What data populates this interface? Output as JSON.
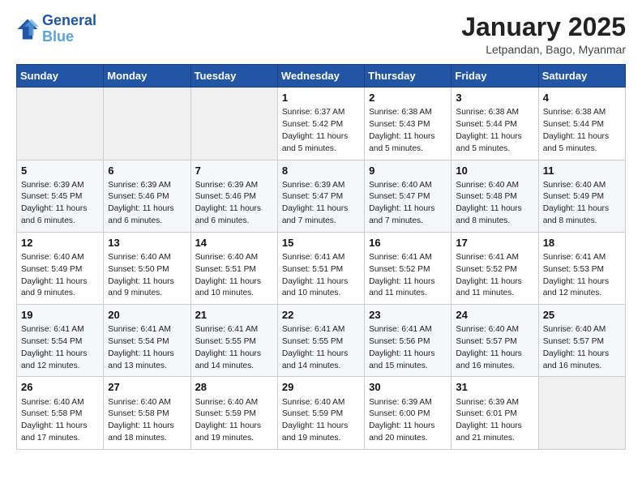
{
  "logo": {
    "text_general": "General",
    "text_blue": "Blue"
  },
  "header": {
    "month": "January 2025",
    "location": "Letpandan, Bago, Myanmar"
  },
  "weekdays": [
    "Sunday",
    "Monday",
    "Tuesday",
    "Wednesday",
    "Thursday",
    "Friday",
    "Saturday"
  ],
  "weeks": [
    [
      {
        "day": "",
        "info": ""
      },
      {
        "day": "",
        "info": ""
      },
      {
        "day": "",
        "info": ""
      },
      {
        "day": "1",
        "info": "Sunrise: 6:37 AM\nSunset: 5:42 PM\nDaylight: 11 hours\nand 5 minutes."
      },
      {
        "day": "2",
        "info": "Sunrise: 6:38 AM\nSunset: 5:43 PM\nDaylight: 11 hours\nand 5 minutes."
      },
      {
        "day": "3",
        "info": "Sunrise: 6:38 AM\nSunset: 5:44 PM\nDaylight: 11 hours\nand 5 minutes."
      },
      {
        "day": "4",
        "info": "Sunrise: 6:38 AM\nSunset: 5:44 PM\nDaylight: 11 hours\nand 5 minutes."
      }
    ],
    [
      {
        "day": "5",
        "info": "Sunrise: 6:39 AM\nSunset: 5:45 PM\nDaylight: 11 hours\nand 6 minutes."
      },
      {
        "day": "6",
        "info": "Sunrise: 6:39 AM\nSunset: 5:46 PM\nDaylight: 11 hours\nand 6 minutes."
      },
      {
        "day": "7",
        "info": "Sunrise: 6:39 AM\nSunset: 5:46 PM\nDaylight: 11 hours\nand 6 minutes."
      },
      {
        "day": "8",
        "info": "Sunrise: 6:39 AM\nSunset: 5:47 PM\nDaylight: 11 hours\nand 7 minutes."
      },
      {
        "day": "9",
        "info": "Sunrise: 6:40 AM\nSunset: 5:47 PM\nDaylight: 11 hours\nand 7 minutes."
      },
      {
        "day": "10",
        "info": "Sunrise: 6:40 AM\nSunset: 5:48 PM\nDaylight: 11 hours\nand 8 minutes."
      },
      {
        "day": "11",
        "info": "Sunrise: 6:40 AM\nSunset: 5:49 PM\nDaylight: 11 hours\nand 8 minutes."
      }
    ],
    [
      {
        "day": "12",
        "info": "Sunrise: 6:40 AM\nSunset: 5:49 PM\nDaylight: 11 hours\nand 9 minutes."
      },
      {
        "day": "13",
        "info": "Sunrise: 6:40 AM\nSunset: 5:50 PM\nDaylight: 11 hours\nand 9 minutes."
      },
      {
        "day": "14",
        "info": "Sunrise: 6:40 AM\nSunset: 5:51 PM\nDaylight: 11 hours\nand 10 minutes."
      },
      {
        "day": "15",
        "info": "Sunrise: 6:41 AM\nSunset: 5:51 PM\nDaylight: 11 hours\nand 10 minutes."
      },
      {
        "day": "16",
        "info": "Sunrise: 6:41 AM\nSunset: 5:52 PM\nDaylight: 11 hours\nand 11 minutes."
      },
      {
        "day": "17",
        "info": "Sunrise: 6:41 AM\nSunset: 5:52 PM\nDaylight: 11 hours\nand 11 minutes."
      },
      {
        "day": "18",
        "info": "Sunrise: 6:41 AM\nSunset: 5:53 PM\nDaylight: 11 hours\nand 12 minutes."
      }
    ],
    [
      {
        "day": "19",
        "info": "Sunrise: 6:41 AM\nSunset: 5:54 PM\nDaylight: 11 hours\nand 12 minutes."
      },
      {
        "day": "20",
        "info": "Sunrise: 6:41 AM\nSunset: 5:54 PM\nDaylight: 11 hours\nand 13 minutes."
      },
      {
        "day": "21",
        "info": "Sunrise: 6:41 AM\nSunset: 5:55 PM\nDaylight: 11 hours\nand 14 minutes."
      },
      {
        "day": "22",
        "info": "Sunrise: 6:41 AM\nSunset: 5:55 PM\nDaylight: 11 hours\nand 14 minutes."
      },
      {
        "day": "23",
        "info": "Sunrise: 6:41 AM\nSunset: 5:56 PM\nDaylight: 11 hours\nand 15 minutes."
      },
      {
        "day": "24",
        "info": "Sunrise: 6:40 AM\nSunset: 5:57 PM\nDaylight: 11 hours\nand 16 minutes."
      },
      {
        "day": "25",
        "info": "Sunrise: 6:40 AM\nSunset: 5:57 PM\nDaylight: 11 hours\nand 16 minutes."
      }
    ],
    [
      {
        "day": "26",
        "info": "Sunrise: 6:40 AM\nSunset: 5:58 PM\nDaylight: 11 hours\nand 17 minutes."
      },
      {
        "day": "27",
        "info": "Sunrise: 6:40 AM\nSunset: 5:58 PM\nDaylight: 11 hours\nand 18 minutes."
      },
      {
        "day": "28",
        "info": "Sunrise: 6:40 AM\nSunset: 5:59 PM\nDaylight: 11 hours\nand 19 minutes."
      },
      {
        "day": "29",
        "info": "Sunrise: 6:40 AM\nSunset: 5:59 PM\nDaylight: 11 hours\nand 19 minutes."
      },
      {
        "day": "30",
        "info": "Sunrise: 6:39 AM\nSunset: 6:00 PM\nDaylight: 11 hours\nand 20 minutes."
      },
      {
        "day": "31",
        "info": "Sunrise: 6:39 AM\nSunset: 6:01 PM\nDaylight: 11 hours\nand 21 minutes."
      },
      {
        "day": "",
        "info": ""
      }
    ]
  ]
}
